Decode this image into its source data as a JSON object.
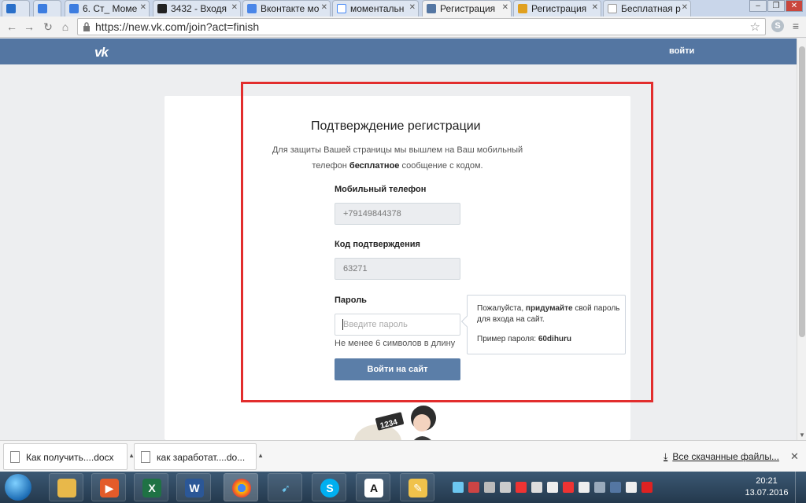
{
  "browser": {
    "tabs": [
      {
        "label": ""
      },
      {
        "label": ""
      },
      {
        "label": "6. Ст_ Моме"
      },
      {
        "label": "3432 - Входя"
      },
      {
        "label": "Вконтакте мо"
      },
      {
        "label": "моментальн"
      },
      {
        "label": "Регистрация"
      },
      {
        "label": "Регистрация"
      },
      {
        "label": "Бесплатная р"
      }
    ],
    "url": "https://new.vk.com/join?act=finish"
  },
  "vk_header": {
    "logo": "vk",
    "login_link": "войти"
  },
  "form": {
    "title": "Подтверждение регистрации",
    "desc_part1": "Для защиты Вашей страницы мы вышлем на Ваш мобильный телефон ",
    "desc_bold": "бесплатное",
    "desc_part2": " сообщение с кодом.",
    "phone_label": "Мобильный телефон",
    "phone_value": "+79149844378",
    "code_label": "Код подтверждения",
    "code_value": "63271",
    "password_label": "Пароль",
    "password_placeholder": "Введите пароль",
    "password_hint": "Не менее 6 символов в длину",
    "submit_label": "Войти на сайт"
  },
  "tooltip": {
    "line1_prefix": "Пожалуйста, ",
    "line1_bold": "придумайте",
    "line1_suffix": " свой пароль для входа на сайт.",
    "example_prefix": "Пример пароля: ",
    "example_value": "60dihuru"
  },
  "illustration_text": "1234",
  "downloads": {
    "items": [
      {
        "label": "Как получить....docx"
      },
      {
        "label": "как заработат....do..."
      }
    ],
    "all_label": "Все скачанные файлы..."
  },
  "taskbar": {
    "time": "20:21",
    "date": "13.07.2016"
  },
  "colors": {
    "vk_blue": "#5476a2",
    "button_blue": "#5b7ea8",
    "highlight_red": "#e22d2d"
  }
}
